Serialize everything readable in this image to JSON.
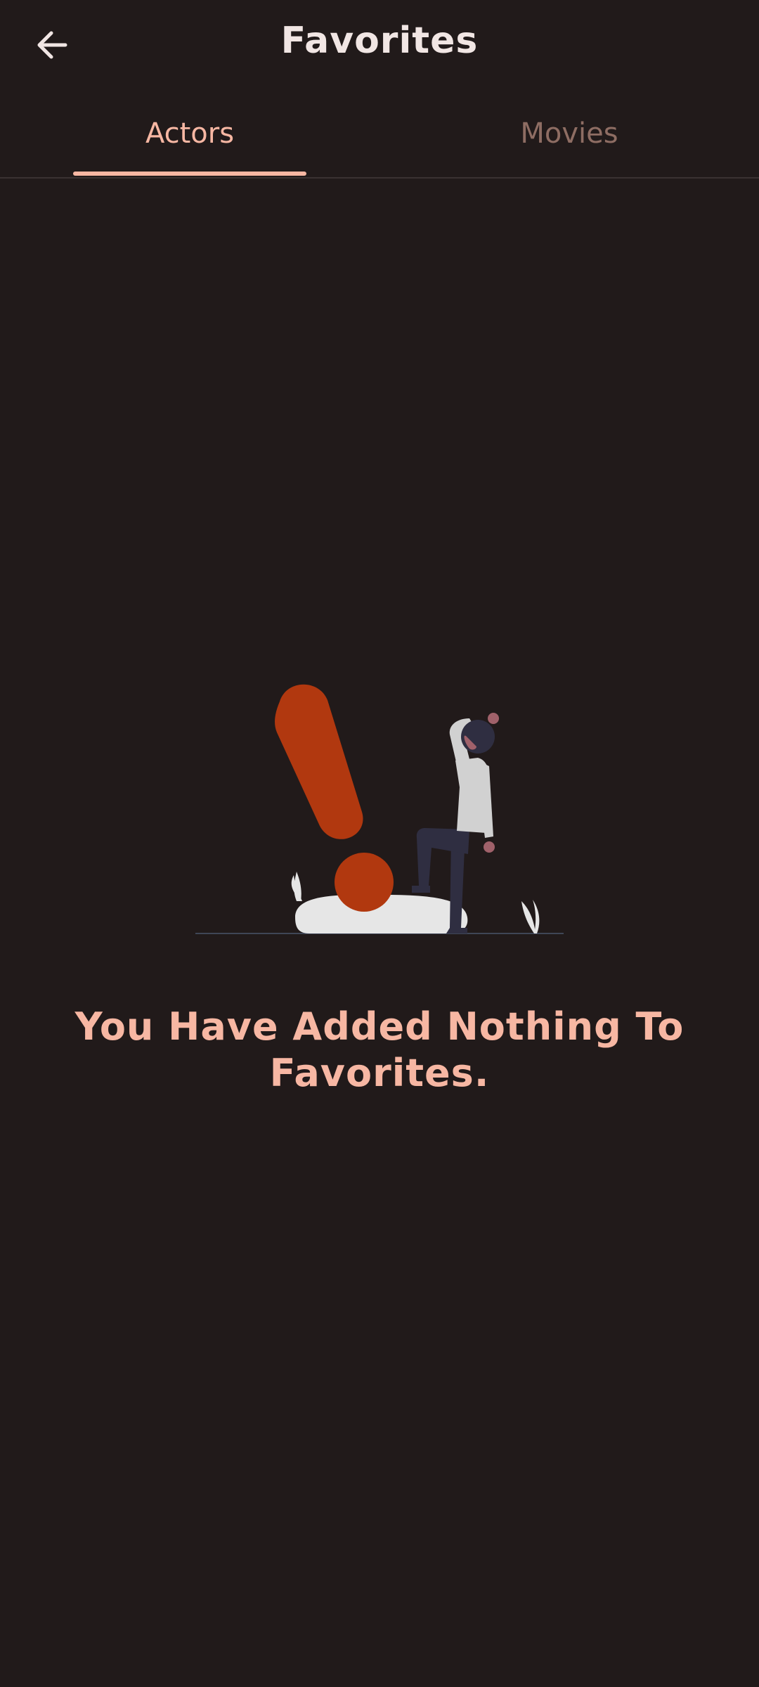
{
  "header": {
    "title": "Favorites",
    "back_icon": "arrow-left-icon"
  },
  "tabs": [
    {
      "label": "Actors",
      "active": true
    },
    {
      "label": "Movies",
      "active": false
    }
  ],
  "empty_state": {
    "illustration": "exclamation-person-illustration",
    "message": "You Have Added Nothing To Favorites."
  },
  "colors": {
    "background": "#211a1a",
    "accent": "#f7b7a3",
    "title_text": "#f1e6e4",
    "inactive_tab": "#8e6d63",
    "illustration_orange": "#b1380f"
  }
}
